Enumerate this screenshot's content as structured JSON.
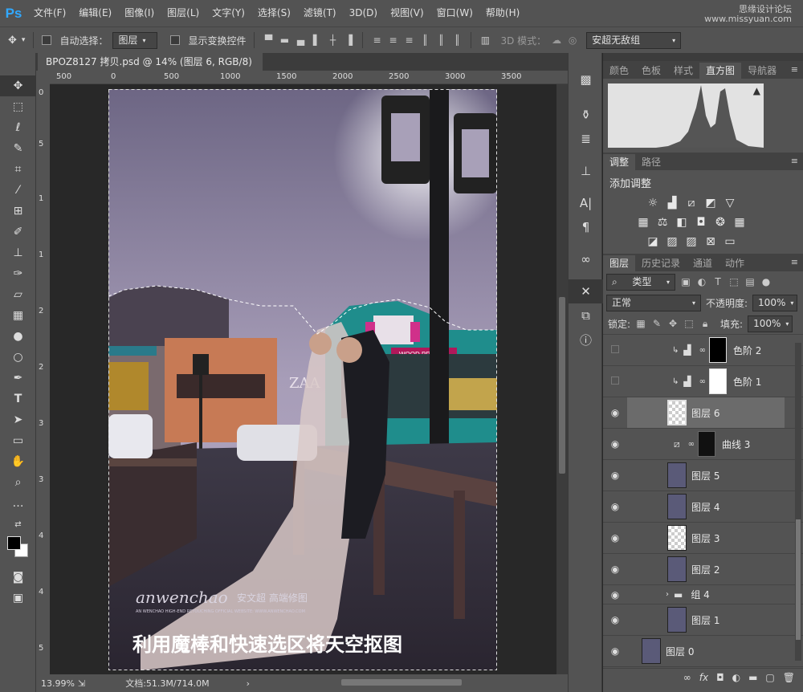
{
  "app": {
    "logo": "Ps"
  },
  "menu": [
    "文件(F)",
    "编辑(E)",
    "图像(I)",
    "图层(L)",
    "文字(Y)",
    "选择(S)",
    "滤镜(T)",
    "3D(D)",
    "视图(V)",
    "窗口(W)",
    "帮助(H)"
  ],
  "watermark": {
    "line1": "思缘设计论坛",
    "line2": "www.missyuan.com"
  },
  "options": {
    "auto_select_label": "自动选择：",
    "auto_select_value": "图层",
    "show_transform_label": "显示变换控件",
    "mode_3d_label": "3D 模式：",
    "workspace_value": "安超无敌组"
  },
  "document": {
    "tab_title": "BPOZ8127 拷贝.psd @ 14% (图层 6, RGB/8) *",
    "ruler_h": [
      "500",
      "0",
      "500",
      "1000",
      "1500",
      "2000",
      "2500",
      "3000",
      "3500"
    ],
    "ruler_v": [
      "0",
      "5",
      "1",
      "1",
      "2",
      "2",
      "3",
      "3",
      "4",
      "4",
      "5"
    ],
    "zoom": "13.99%",
    "doc_info": "文档:51.3M/714.0M",
    "image_caption": "利用魔棒和快速选区将天空抠图",
    "image_brand": "anwenchao",
    "image_brand_cn": "安文超 高端修图",
    "image_brand_small": "AN WENCHAO HIGH-END RETOUCHING OFFICIAL WEBSITE: WWW.ANWENCHAO.COM",
    "sign_text": "WOOD PRINT",
    "sign_zaa": "ZAA",
    "sign_print": "PRINT"
  },
  "panels": {
    "top_tabs": [
      "颜色",
      "色板",
      "样式",
      "直方图",
      "导航器"
    ],
    "top_active": "直方图",
    "adjust_tabs": [
      "调整",
      "路径"
    ],
    "adjust_title": "添加调整",
    "layer_tabs": [
      "图层",
      "历史记录",
      "通道",
      "动作"
    ],
    "filter_kind": "类型",
    "blend_mode": "正常",
    "opacity_label": "不透明度:",
    "opacity_value": "100%",
    "lock_label": "锁定:",
    "fill_label": "填充:",
    "fill_value": "100%"
  },
  "layers": [
    {
      "name": "色阶 2",
      "visible": false,
      "type": "levels"
    },
    {
      "name": "色阶 1",
      "visible": false,
      "type": "levels"
    },
    {
      "name": "图层 6",
      "visible": true,
      "type": "layer",
      "selected": true
    },
    {
      "name": "曲线 3",
      "visible": true,
      "type": "curves"
    },
    {
      "name": "图层 5",
      "visible": true,
      "type": "photo"
    },
    {
      "name": "图层 4",
      "visible": true,
      "type": "photo"
    },
    {
      "name": "图层 3",
      "visible": true,
      "type": "transparent"
    },
    {
      "name": "图层 2",
      "visible": true,
      "type": "photo"
    },
    {
      "name": "组 4",
      "visible": true,
      "type": "group"
    },
    {
      "name": "图层 1",
      "visible": true,
      "type": "photo"
    },
    {
      "name": "图层 0",
      "visible": true,
      "type": "photo"
    }
  ],
  "colors": {
    "accent": "#31a8ff",
    "ui_bg": "#535353",
    "dark_bg": "#282828"
  }
}
